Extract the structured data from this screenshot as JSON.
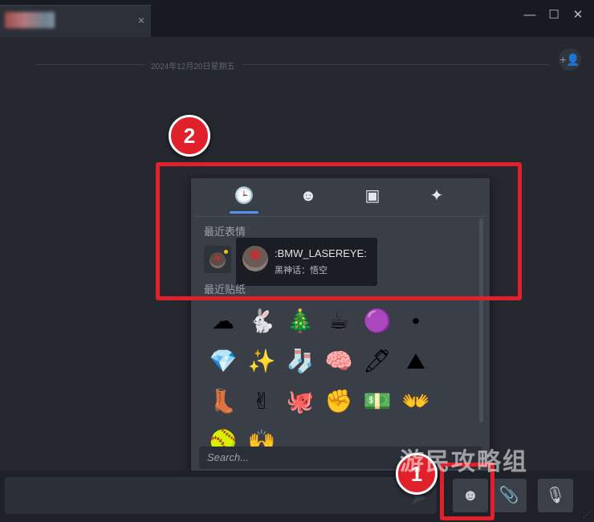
{
  "window": {
    "tab_close": "×",
    "minimize": "—",
    "maximize": "☐",
    "close": "✕"
  },
  "chat": {
    "date_divider": "2024年12月20日星期五",
    "add_friend_icon": "+👤"
  },
  "picker": {
    "tabs": [
      {
        "name": "recent",
        "icon": "🕒",
        "active": true
      },
      {
        "name": "emoticons",
        "icon": "☻"
      },
      {
        "name": "stickers",
        "icon": "▣"
      },
      {
        "name": "effects",
        "icon": "✦"
      }
    ],
    "recent_emoticons_label": "最近表情",
    "recent_stickers_label": "最近贴纸",
    "tooltip": {
      "name": ":BMW_LASEREYE:",
      "game": "黑神话：悟空"
    },
    "stickers": [
      "☁",
      "🐇",
      "🎄",
      "☕",
      "🟣",
      "•",
      "💎",
      "✨",
      "🧦",
      "🧠",
      "🖊",
      "⛰",
      "👢",
      "✌",
      "🐙",
      "✊",
      "💵",
      "👐",
      "🥎",
      "🙌"
    ],
    "search_placeholder": "Search..."
  },
  "bottom_bar": {
    "send_icon": "➤",
    "emoji_icon": "☻",
    "attach_icon": "📎",
    "voice_icon": "🎙"
  },
  "annotations": {
    "badge_1": "1",
    "badge_2": "2",
    "watermark": "游民攻略组",
    "color": "#e0202a"
  }
}
